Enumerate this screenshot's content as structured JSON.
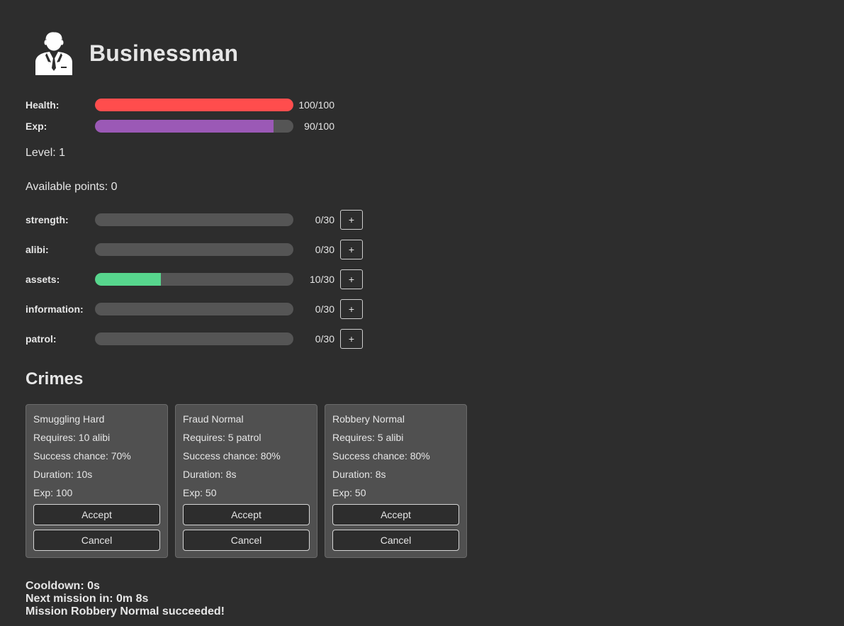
{
  "character": {
    "title": "Businessman",
    "avatar_icon": "businessman-icon"
  },
  "vitals": [
    {
      "label": "Health:",
      "value": "100/100",
      "fraction": 1.0,
      "color": "#ff4d4d"
    },
    {
      "label": "Exp:",
      "value": "90/100",
      "fraction": 0.9,
      "color": "#9b59b6"
    }
  ],
  "level_text": "Level: 1",
  "points_text": "Available points: 0",
  "attributes": [
    {
      "label": "strength:",
      "value": "0/30",
      "fraction": 0,
      "button": "+"
    },
    {
      "label": "alibi:",
      "value": "0/30",
      "fraction": 0,
      "button": "+"
    },
    {
      "label": "assets:",
      "value": "10/30",
      "fraction": 0.3333,
      "button": "+"
    },
    {
      "label": "information:",
      "value": "0/30",
      "fraction": 0,
      "button": "+"
    },
    {
      "label": "patrol:",
      "value": "0/30",
      "fraction": 0,
      "button": "+"
    }
  ],
  "attribute_fill_color": "#57d68d",
  "crimes": {
    "title": "Crimes",
    "cards": [
      {
        "name": "Smuggling Hard",
        "requires": "Requires: 10 alibi",
        "success": "Success chance: 70%",
        "duration": "Duration: 10s",
        "exp": "Exp: 100",
        "accept_label": "Accept",
        "cancel_label": "Cancel"
      },
      {
        "name": "Fraud Normal",
        "requires": "Requires: 5 patrol",
        "success": "Success chance: 80%",
        "duration": "Duration: 8s",
        "exp": "Exp: 50",
        "accept_label": "Accept",
        "cancel_label": "Cancel"
      },
      {
        "name": "Robbery Normal",
        "requires": "Requires: 5 alibi",
        "success": "Success chance: 80%",
        "duration": "Duration: 8s",
        "exp": "Exp: 50",
        "accept_label": "Accept",
        "cancel_label": "Cancel"
      }
    ]
  },
  "status": {
    "cooldown": "Cooldown: 0s",
    "next_mission": "Next mission in: 0m 8s",
    "message": "Mission Robbery Normal succeeded!"
  }
}
